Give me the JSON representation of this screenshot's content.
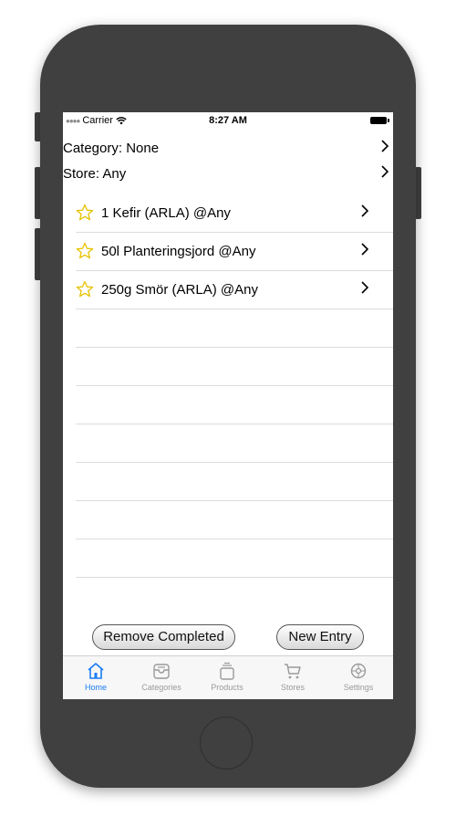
{
  "status_bar": {
    "carrier": "Carrier",
    "time": "8:27 AM"
  },
  "filters": {
    "category": "Category: None",
    "store": "Store: Any"
  },
  "items": [
    {
      "label": "1 Kefir (ARLA)  @Any",
      "starred": false
    },
    {
      "label": "50l  Planteringsjord  @Any",
      "starred": false
    },
    {
      "label": "250g  Smör (ARLA)  @Any",
      "starred": false
    }
  ],
  "actions": {
    "remove_completed": "Remove Completed",
    "new_entry": "New Entry"
  },
  "tabs": [
    {
      "label": "Home",
      "icon": "home-icon",
      "active": true
    },
    {
      "label": "Categories",
      "icon": "categories-icon",
      "active": false
    },
    {
      "label": "Products",
      "icon": "products-icon",
      "active": false
    },
    {
      "label": "Stores",
      "icon": "cart-icon",
      "active": false
    },
    {
      "label": "Settings",
      "icon": "gear-icon",
      "active": false
    }
  ],
  "colors": {
    "accent": "#1a7cf5",
    "star": "#e6c200",
    "device": "#404040"
  }
}
